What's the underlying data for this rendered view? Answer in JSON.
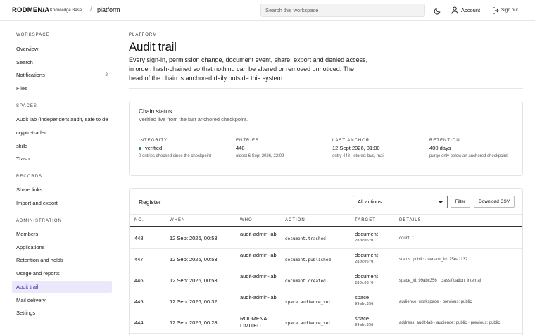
{
  "topbar": {
    "brand": "RODMEN/​A",
    "brand_sub": "Knowledge Base",
    "separator": "/",
    "workspace": "platform",
    "search_placeholder": "Search this workspace",
    "account_label": "Account",
    "signout_label": "Sign out"
  },
  "sidebar": {
    "workspace_heading": "WORKSPACE",
    "workspace_items": [
      {
        "label": "Overview"
      },
      {
        "label": "Search"
      },
      {
        "label": "Notifications",
        "count": "2"
      },
      {
        "label": "Files"
      }
    ],
    "spaces_heading": "SPACES",
    "spaces_items": [
      {
        "label": "Audit lab (independent audit, safe to de"
      },
      {
        "label": "crypto-trader"
      },
      {
        "label": "skills"
      },
      {
        "label": "Trash"
      }
    ],
    "records_heading": "RECORDS",
    "records_items": [
      {
        "label": "Share links"
      },
      {
        "label": "Import and export"
      }
    ],
    "admin_heading": "ADMINISTRATION",
    "admin_items": [
      {
        "label": "Members"
      },
      {
        "label": "Applications"
      },
      {
        "label": "Retention and holds"
      },
      {
        "label": "Usage and reports"
      },
      {
        "label": "Audit trail"
      },
      {
        "label": "Mail delivery"
      },
      {
        "label": "Settings"
      }
    ]
  },
  "page": {
    "kicker": "PLATFORM",
    "title": "Audit trail",
    "description": "Every sign-in, permission change, document event, share, export and denied access, in order, hash-chained so that nothing can be altered or removed unnoticed. The head of the chain is anchored daily outside this system."
  },
  "chain": {
    "title": "Chain status",
    "subtitle": "Verified live from the last anchored checkpoint.",
    "integrity": {
      "label": "INTEGRITY",
      "value": "verified",
      "note": "0 entries checked since the checkpoint",
      "status_color": "#1f8a4c"
    },
    "entries": {
      "label": "ENTRIES",
      "value": "448",
      "note": "oldest 6 Sept 2026, 22:09"
    },
    "anchor": {
      "label": "LAST ANCHOR",
      "value": "12 Sept 2026, 01:00",
      "note": "entry 448 · stores: bus, mail"
    },
    "retention": {
      "label": "RETENTION",
      "value": "400 days",
      "note": "purge only below an anchored checkpoint"
    }
  },
  "register": {
    "title": "Register",
    "filter_value": "All actions",
    "filter_button": "Filter",
    "download_button": "Download CSV",
    "columns": {
      "no": "NO.",
      "when": "WHEN",
      "who": "WHO",
      "action": "ACTION",
      "target": "TARGET",
      "details": "DETAILS"
    },
    "rows": [
      {
        "no": "448",
        "when": "12 Sept 2026, 00:53",
        "who": "audit-admin-lab",
        "action": "document.trashed",
        "target": "document",
        "target_id": "280c06f0",
        "details": "count: 1"
      },
      {
        "no": "447",
        "when": "12 Sept 2026, 00:53",
        "who": "audit-admin-lab",
        "action": "document.published",
        "target": "document",
        "target_id": "280c06f0",
        "details": "status: public · version_id: 25ea1132"
      },
      {
        "no": "446",
        "when": "12 Sept 2026, 00:53",
        "who": "audit-admin-lab",
        "action": "document.created",
        "target": "document",
        "target_id": "280c06f0",
        "details": "space_id: 99abc356 · classification: internal"
      },
      {
        "no": "445",
        "when": "12 Sept 2026, 00:32",
        "who": "audit-admin-lab",
        "action": "space.audience_set",
        "target": "space",
        "target_id": "99abc356",
        "details": "audience: workspace · previous: public"
      },
      {
        "no": "444",
        "when": "12 Sept 2026, 00:28",
        "who": "RODMENA LIMITED",
        "action": "space.audience_set",
        "target": "space",
        "target_id": "99abc356",
        "details": "address: audit-lab · audience: public · previous: public"
      }
    ]
  }
}
